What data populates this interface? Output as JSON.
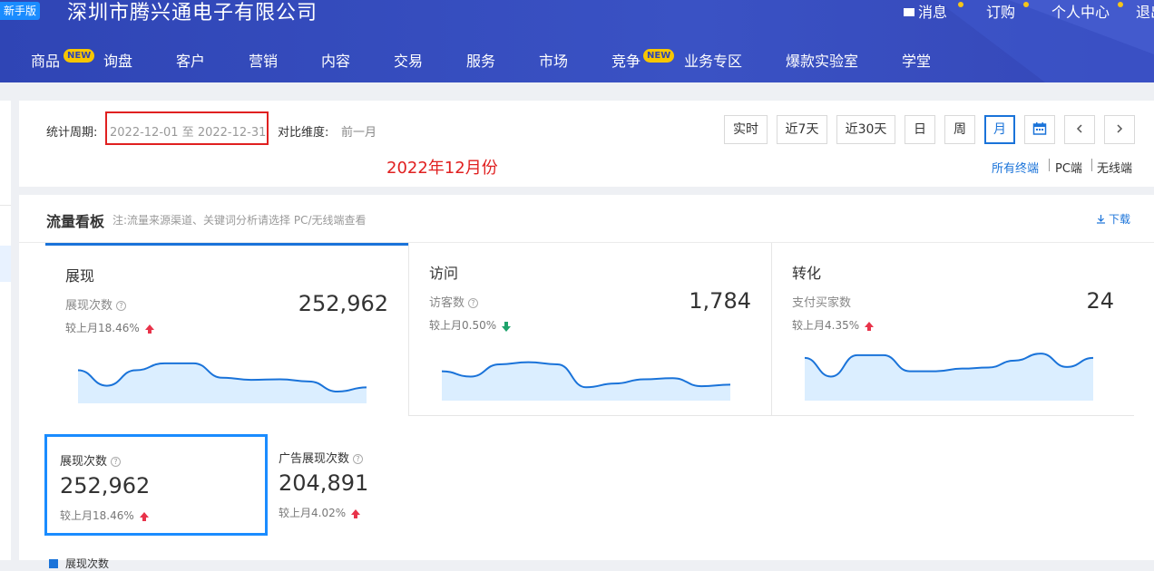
{
  "header": {
    "new_version_badge": "新手版",
    "company": "深圳市腾兴通电子有限公司",
    "links": [
      "消息",
      "订购",
      "个人中心",
      "退出"
    ],
    "nav": [
      "商品",
      "询盘",
      "客户",
      "营销",
      "内容",
      "交易",
      "服务",
      "市场",
      "竞争",
      "业务专区",
      "爆款实验室",
      "学堂"
    ],
    "new_tag": "NEW"
  },
  "filter": {
    "period_label": "统计周期:",
    "period_value": "2022-12-01 至 2022-12-31",
    "compare_label": "对比维度:",
    "compare_value": "前一月",
    "annotation": "2022年12月份",
    "buttons": [
      "实时",
      "近7天",
      "近30天",
      "日",
      "周",
      "月"
    ],
    "active_button": "月",
    "terminals": [
      "所有终端",
      "PC端",
      "无线端"
    ]
  },
  "board": {
    "title": "流量看板",
    "note": "注:流量来源渠道、关键词分析请选择 PC/无线端查看",
    "download": "下载",
    "cards": [
      {
        "title": "展现",
        "metric": "展现次数",
        "value": "252,962",
        "compare": "较上月18.46%",
        "trend": "up",
        "spark": [
          0.62,
          0.33,
          0.62,
          0.75,
          0.75,
          0.48,
          0.44,
          0.45,
          0.41,
          0.22,
          0.3
        ]
      },
      {
        "title": "访问",
        "metric": "访客数",
        "value": "1,784",
        "compare": "较上月0.50%",
        "trend": "down",
        "spark": [
          0.55,
          0.45,
          0.68,
          0.72,
          0.68,
          0.25,
          0.32,
          0.4,
          0.42,
          0.27,
          0.3
        ]
      },
      {
        "title": "转化",
        "metric": "支付买家数",
        "value": "24",
        "compare": "较上月4.35%",
        "trend": "up",
        "spark": [
          0.8,
          0.45,
          0.85,
          0.85,
          0.55,
          0.55,
          0.6,
          0.62,
          0.75,
          0.88,
          0.63,
          0.8
        ]
      }
    ],
    "sub_metrics": [
      {
        "name": "展现次数",
        "value": "252,962",
        "compare": "较上月18.46%",
        "trend": "up"
      },
      {
        "name": "广告展现次数",
        "value": "204,891",
        "compare": "较上月4.02%",
        "trend": "up"
      }
    ],
    "legend": "展现次数"
  },
  "colors": {
    "header": "#3547b8",
    "accent": "#1a73d9",
    "highlight": "#e02020",
    "up": "#e8334a",
    "down": "#1ea36b",
    "spark_fill": "#dbeeff",
    "spark_line": "#1a73d9"
  }
}
